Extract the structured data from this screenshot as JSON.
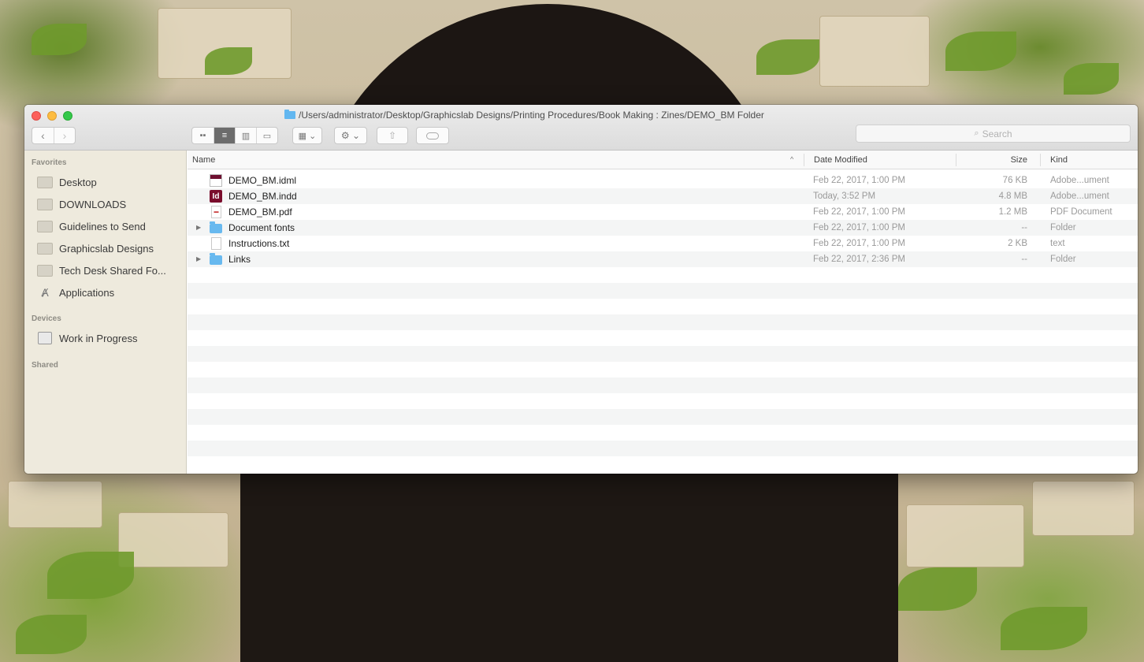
{
  "window": {
    "path_title": "/Users/administrator/Desktop/Graphicslab Designs/Printing Procedures/Book Making : Zines/DEMO_BM Folder"
  },
  "toolbar": {
    "back_glyph": "‹",
    "forward_glyph": "›",
    "search_placeholder": "Search",
    "view_modes": [
      "icon",
      "list",
      "column",
      "cover-flow"
    ],
    "active_view": "list"
  },
  "sidebar": {
    "favorites_heading": "Favorites",
    "favorites": [
      {
        "label": "Desktop",
        "icon": "folder-icon"
      },
      {
        "label": "DOWNLOADS",
        "icon": "folder-icon"
      },
      {
        "label": "Guidelines to Send",
        "icon": "folder-icon"
      },
      {
        "label": "Graphicslab Designs",
        "icon": "folder-icon"
      },
      {
        "label": "Tech Desk Shared Fo...",
        "icon": "folder-icon"
      },
      {
        "label": "Applications",
        "icon": "applications-icon"
      }
    ],
    "devices_heading": "Devices",
    "devices": [
      {
        "label": "Work in Progress",
        "icon": "disk-icon"
      }
    ],
    "shared_heading": "Shared"
  },
  "columns": {
    "name": "Name",
    "date_modified": "Date Modified",
    "size": "Size",
    "kind": "Kind"
  },
  "files": [
    {
      "name": "DEMO_BM.idml",
      "date": "Feb 22, 2017, 1:00 PM",
      "size": "76 KB",
      "kind": "Adobe...ument",
      "icon": "idml-file-icon"
    },
    {
      "name": "DEMO_BM.indd",
      "date": "Today, 3:52 PM",
      "size": "4.8 MB",
      "kind": "Adobe...ument",
      "icon": "indd-file-icon"
    },
    {
      "name": "DEMO_BM.pdf",
      "date": "Feb 22, 2017, 1:00 PM",
      "size": "1.2 MB",
      "kind": "PDF Document",
      "icon": "pdf-file-icon"
    },
    {
      "name": "Document fonts",
      "date": "Feb 22, 2017, 1:00 PM",
      "size": "--",
      "kind": "Folder",
      "icon": "folder-icon"
    },
    {
      "name": "Instructions.txt",
      "date": "Feb 22, 2017, 1:00 PM",
      "size": "2 KB",
      "kind": "text",
      "icon": "text-file-icon"
    },
    {
      "name": "Links",
      "date": "Feb 22, 2017, 2:36 PM",
      "size": "--",
      "kind": "Folder",
      "icon": "folder-icon"
    }
  ],
  "colors": {
    "sidebar_bg": "#eeeadd",
    "folder_blue": "#68b9ef",
    "indd_red": "#7a0d2c"
  }
}
